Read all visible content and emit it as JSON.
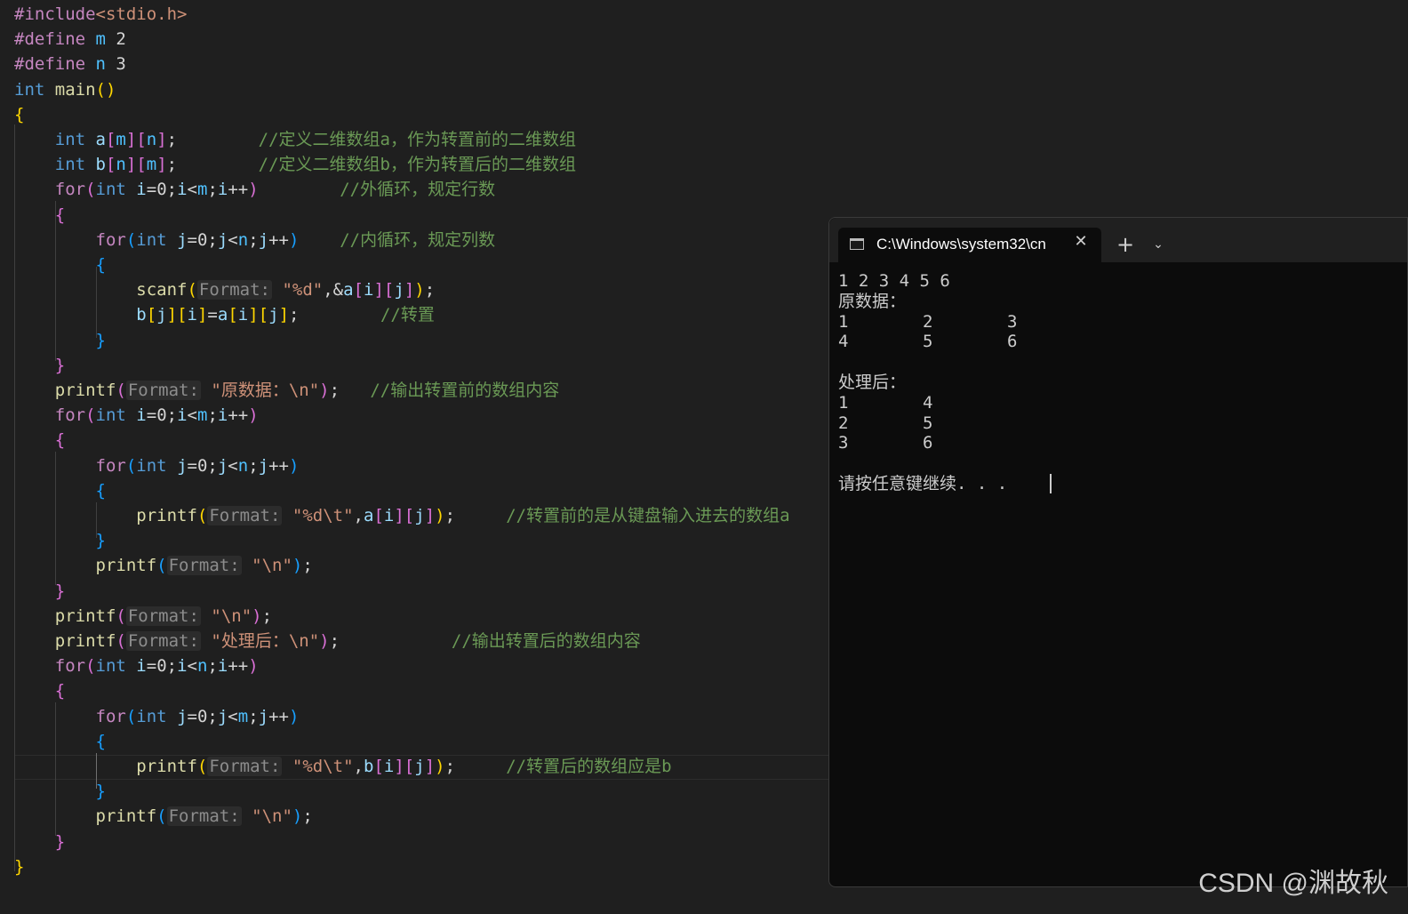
{
  "editor": {
    "lines": [
      [
        {
          "t": "#include",
          "c": "pp"
        },
        {
          "t": "<stdio.h>",
          "c": "str"
        }
      ],
      [
        {
          "t": "#define ",
          "c": "pp"
        },
        {
          "t": "m",
          "c": "const"
        },
        {
          "t": " 2",
          "c": "op"
        }
      ],
      [
        {
          "t": "#define ",
          "c": "pp"
        },
        {
          "t": "n",
          "c": "const"
        },
        {
          "t": " 3",
          "c": "op"
        }
      ],
      [
        {
          "t": "int ",
          "c": "kw"
        },
        {
          "t": "main",
          "c": "fn"
        },
        {
          "t": "()",
          "c": "br1"
        }
      ],
      [
        {
          "t": "{",
          "c": "br1"
        }
      ],
      [
        {
          "t": "    int ",
          "c": "kw"
        },
        {
          "t": "a",
          "c": "var"
        },
        {
          "t": "[",
          "c": "br2"
        },
        {
          "t": "m",
          "c": "const"
        },
        {
          "t": "][",
          "c": "br2"
        },
        {
          "t": "n",
          "c": "const"
        },
        {
          "t": "]",
          "c": "br2"
        },
        {
          "t": ";        ",
          "c": "op"
        },
        {
          "t": "//定义二维数组a，作为转置前的二维数组",
          "c": "cmt"
        }
      ],
      [
        {
          "t": "    int ",
          "c": "kw"
        },
        {
          "t": "b",
          "c": "var"
        },
        {
          "t": "[",
          "c": "br2"
        },
        {
          "t": "n",
          "c": "const"
        },
        {
          "t": "][",
          "c": "br2"
        },
        {
          "t": "m",
          "c": "const"
        },
        {
          "t": "]",
          "c": "br2"
        },
        {
          "t": ";        ",
          "c": "op"
        },
        {
          "t": "//定义二维数组b，作为转置后的二维数组",
          "c": "cmt"
        }
      ],
      [
        {
          "t": "    for",
          "c": "pp"
        },
        {
          "t": "(",
          "c": "br2"
        },
        {
          "t": "int ",
          "c": "kw"
        },
        {
          "t": "i",
          "c": "var"
        },
        {
          "t": "=0;",
          "c": "op"
        },
        {
          "t": "i",
          "c": "var"
        },
        {
          "t": "<",
          "c": "op"
        },
        {
          "t": "m",
          "c": "const"
        },
        {
          "t": ";",
          "c": "op"
        },
        {
          "t": "i",
          "c": "var"
        },
        {
          "t": "++",
          "c": "op"
        },
        {
          "t": ")",
          "c": "br2"
        },
        {
          "t": "        ",
          "c": "op"
        },
        {
          "t": "//外循环，规定行数",
          "c": "cmt"
        }
      ],
      [
        {
          "t": "    {",
          "c": "br2"
        }
      ],
      [
        {
          "t": "        for",
          "c": "pp"
        },
        {
          "t": "(",
          "c": "br3"
        },
        {
          "t": "int ",
          "c": "kw"
        },
        {
          "t": "j",
          "c": "var"
        },
        {
          "t": "=0;",
          "c": "op"
        },
        {
          "t": "j",
          "c": "var"
        },
        {
          "t": "<",
          "c": "op"
        },
        {
          "t": "n",
          "c": "const"
        },
        {
          "t": ";",
          "c": "op"
        },
        {
          "t": "j",
          "c": "var"
        },
        {
          "t": "++",
          "c": "op"
        },
        {
          "t": ")",
          "c": "br3"
        },
        {
          "t": "    ",
          "c": "op"
        },
        {
          "t": "//内循环，规定列数",
          "c": "cmt"
        }
      ],
      [
        {
          "t": "        {",
          "c": "br3"
        }
      ],
      [
        {
          "t": "            scanf",
          "c": "fn"
        },
        {
          "t": "(",
          "c": "br1"
        },
        {
          "t": "Format:",
          "c": "hint"
        },
        {
          "t": " ",
          "c": "op"
        },
        {
          "t": "\"%d\"",
          "c": "str"
        },
        {
          "t": ",&",
          "c": "op"
        },
        {
          "t": "a",
          "c": "var"
        },
        {
          "t": "[",
          "c": "br2"
        },
        {
          "t": "i",
          "c": "var"
        },
        {
          "t": "][",
          "c": "br2"
        },
        {
          "t": "j",
          "c": "var"
        },
        {
          "t": "]",
          "c": "br2"
        },
        {
          "t": ")",
          "c": "br1"
        },
        {
          "t": ";",
          "c": "op"
        }
      ],
      [
        {
          "t": "            b",
          "c": "var"
        },
        {
          "t": "[",
          "c": "br1"
        },
        {
          "t": "j",
          "c": "var"
        },
        {
          "t": "][",
          "c": "br1"
        },
        {
          "t": "i",
          "c": "var"
        },
        {
          "t": "]",
          "c": "br1"
        },
        {
          "t": "=",
          "c": "op"
        },
        {
          "t": "a",
          "c": "var"
        },
        {
          "t": "[",
          "c": "br1"
        },
        {
          "t": "i",
          "c": "var"
        },
        {
          "t": "][",
          "c": "br1"
        },
        {
          "t": "j",
          "c": "var"
        },
        {
          "t": "]",
          "c": "br1"
        },
        {
          "t": ";        ",
          "c": "op"
        },
        {
          "t": "//转置",
          "c": "cmt"
        }
      ],
      [
        {
          "t": "        }",
          "c": "br3"
        }
      ],
      [
        {
          "t": "    }",
          "c": "br2"
        }
      ],
      [
        {
          "t": "    printf",
          "c": "fn"
        },
        {
          "t": "(",
          "c": "br2"
        },
        {
          "t": "Format:",
          "c": "hint"
        },
        {
          "t": " ",
          "c": "op"
        },
        {
          "t": "\"原数据：\\n\"",
          "c": "str"
        },
        {
          "t": ")",
          "c": "br2"
        },
        {
          "t": ";   ",
          "c": "op"
        },
        {
          "t": "//输出转置前的数组内容",
          "c": "cmt"
        }
      ],
      [
        {
          "t": "    for",
          "c": "pp"
        },
        {
          "t": "(",
          "c": "br2"
        },
        {
          "t": "int ",
          "c": "kw"
        },
        {
          "t": "i",
          "c": "var"
        },
        {
          "t": "=0;",
          "c": "op"
        },
        {
          "t": "i",
          "c": "var"
        },
        {
          "t": "<",
          "c": "op"
        },
        {
          "t": "m",
          "c": "const"
        },
        {
          "t": ";",
          "c": "op"
        },
        {
          "t": "i",
          "c": "var"
        },
        {
          "t": "++",
          "c": "op"
        },
        {
          "t": ")",
          "c": "br2"
        }
      ],
      [
        {
          "t": "    {",
          "c": "br2"
        }
      ],
      [
        {
          "t": "        for",
          "c": "pp"
        },
        {
          "t": "(",
          "c": "br3"
        },
        {
          "t": "int ",
          "c": "kw"
        },
        {
          "t": "j",
          "c": "var"
        },
        {
          "t": "=0;",
          "c": "op"
        },
        {
          "t": "j",
          "c": "var"
        },
        {
          "t": "<",
          "c": "op"
        },
        {
          "t": "n",
          "c": "const"
        },
        {
          "t": ";",
          "c": "op"
        },
        {
          "t": "j",
          "c": "var"
        },
        {
          "t": "++",
          "c": "op"
        },
        {
          "t": ")",
          "c": "br3"
        }
      ],
      [
        {
          "t": "        {",
          "c": "br3"
        }
      ],
      [
        {
          "t": "            printf",
          "c": "fn"
        },
        {
          "t": "(",
          "c": "br1"
        },
        {
          "t": "Format:",
          "c": "hint"
        },
        {
          "t": " ",
          "c": "op"
        },
        {
          "t": "\"%d\\t\"",
          "c": "str"
        },
        {
          "t": ",",
          "c": "op"
        },
        {
          "t": "a",
          "c": "var"
        },
        {
          "t": "[",
          "c": "br2"
        },
        {
          "t": "i",
          "c": "var"
        },
        {
          "t": "][",
          "c": "br2"
        },
        {
          "t": "j",
          "c": "var"
        },
        {
          "t": "]",
          "c": "br2"
        },
        {
          "t": ")",
          "c": "br1"
        },
        {
          "t": ";     ",
          "c": "op"
        },
        {
          "t": "//转置前的是从键盘输入进去的数组a",
          "c": "cmt"
        }
      ],
      [
        {
          "t": "        }",
          "c": "br3"
        }
      ],
      [
        {
          "t": "        printf",
          "c": "fn"
        },
        {
          "t": "(",
          "c": "br3"
        },
        {
          "t": "Format:",
          "c": "hint"
        },
        {
          "t": " ",
          "c": "op"
        },
        {
          "t": "\"\\n\"",
          "c": "str"
        },
        {
          "t": ")",
          "c": "br3"
        },
        {
          "t": ";",
          "c": "op"
        }
      ],
      [
        {
          "t": "    }",
          "c": "br2"
        }
      ],
      [
        {
          "t": "    printf",
          "c": "fn"
        },
        {
          "t": "(",
          "c": "br2"
        },
        {
          "t": "Format:",
          "c": "hint"
        },
        {
          "t": " ",
          "c": "op"
        },
        {
          "t": "\"\\n\"",
          "c": "str"
        },
        {
          "t": ")",
          "c": "br2"
        },
        {
          "t": ";",
          "c": "op"
        }
      ],
      [
        {
          "t": "    printf",
          "c": "fn"
        },
        {
          "t": "(",
          "c": "br2"
        },
        {
          "t": "Format:",
          "c": "hint"
        },
        {
          "t": " ",
          "c": "op"
        },
        {
          "t": "\"处理后：\\n\"",
          "c": "str"
        },
        {
          "t": ")",
          "c": "br2"
        },
        {
          "t": ";           ",
          "c": "op"
        },
        {
          "t": "//输出转置后的数组内容",
          "c": "cmt"
        }
      ],
      [
        {
          "t": "    for",
          "c": "pp"
        },
        {
          "t": "(",
          "c": "br2"
        },
        {
          "t": "int ",
          "c": "kw"
        },
        {
          "t": "i",
          "c": "var"
        },
        {
          "t": "=0;",
          "c": "op"
        },
        {
          "t": "i",
          "c": "var"
        },
        {
          "t": "<",
          "c": "op"
        },
        {
          "t": "n",
          "c": "const"
        },
        {
          "t": ";",
          "c": "op"
        },
        {
          "t": "i",
          "c": "var"
        },
        {
          "t": "++",
          "c": "op"
        },
        {
          "t": ")",
          "c": "br2"
        }
      ],
      [
        {
          "t": "    {",
          "c": "br2"
        }
      ],
      [
        {
          "t": "        for",
          "c": "pp"
        },
        {
          "t": "(",
          "c": "br3"
        },
        {
          "t": "int ",
          "c": "kw"
        },
        {
          "t": "j",
          "c": "var"
        },
        {
          "t": "=0;",
          "c": "op"
        },
        {
          "t": "j",
          "c": "var"
        },
        {
          "t": "<",
          "c": "op"
        },
        {
          "t": "m",
          "c": "const"
        },
        {
          "t": ";",
          "c": "op"
        },
        {
          "t": "j",
          "c": "var"
        },
        {
          "t": "++",
          "c": "op"
        },
        {
          "t": ")",
          "c": "br3"
        }
      ],
      [
        {
          "t": "        {",
          "c": "br3"
        }
      ],
      [
        {
          "t": "            printf",
          "c": "fn"
        },
        {
          "t": "(",
          "c": "br1"
        },
        {
          "t": "Format:",
          "c": "hint"
        },
        {
          "t": " ",
          "c": "op"
        },
        {
          "t": "\"%d\\t\"",
          "c": "str"
        },
        {
          "t": ",",
          "c": "op"
        },
        {
          "t": "b",
          "c": "var"
        },
        {
          "t": "[",
          "c": "br2"
        },
        {
          "t": "i",
          "c": "var"
        },
        {
          "t": "][",
          "c": "br2"
        },
        {
          "t": "j",
          "c": "var"
        },
        {
          "t": "]",
          "c": "br2"
        },
        {
          "t": ")",
          "c": "br1"
        },
        {
          "t": ";     ",
          "c": "op"
        },
        {
          "t": "//转置后的数组应是b",
          "c": "cmt"
        }
      ],
      [
        {
          "t": "        }",
          "c": "br3"
        }
      ],
      [
        {
          "t": "        printf",
          "c": "fn"
        },
        {
          "t": "(",
          "c": "br3"
        },
        {
          "t": "Format:",
          "c": "hint"
        },
        {
          "t": " ",
          "c": "op"
        },
        {
          "t": "\"\\n\"",
          "c": "str"
        },
        {
          "t": ")",
          "c": "br3"
        },
        {
          "t": ";",
          "c": "op"
        }
      ],
      [
        {
          "t": "    }",
          "c": "br2"
        }
      ],
      [
        {
          "t": "}",
          "c": "br1"
        }
      ]
    ]
  },
  "terminal": {
    "tab_title": "C:\\Windows\\system32\\cn",
    "tab_icon": "terminal-icon",
    "close_glyph": "✕",
    "new_tab_glyph": "+",
    "dropdown_glyph": "⌄",
    "output": [
      [
        "1 2 3 4 5 6"
      ],
      [
        "原数据："
      ],
      [
        "1",
        "2",
        "3"
      ],
      [
        "4",
        "5",
        "6"
      ],
      [
        ""
      ],
      [
        "处理后："
      ],
      [
        "1",
        "4"
      ],
      [
        "2",
        "5"
      ],
      [
        "3",
        "6"
      ],
      [
        ""
      ],
      [
        "请按任意键继续. . ."
      ]
    ]
  },
  "watermark": "CSDN @渊故秋"
}
